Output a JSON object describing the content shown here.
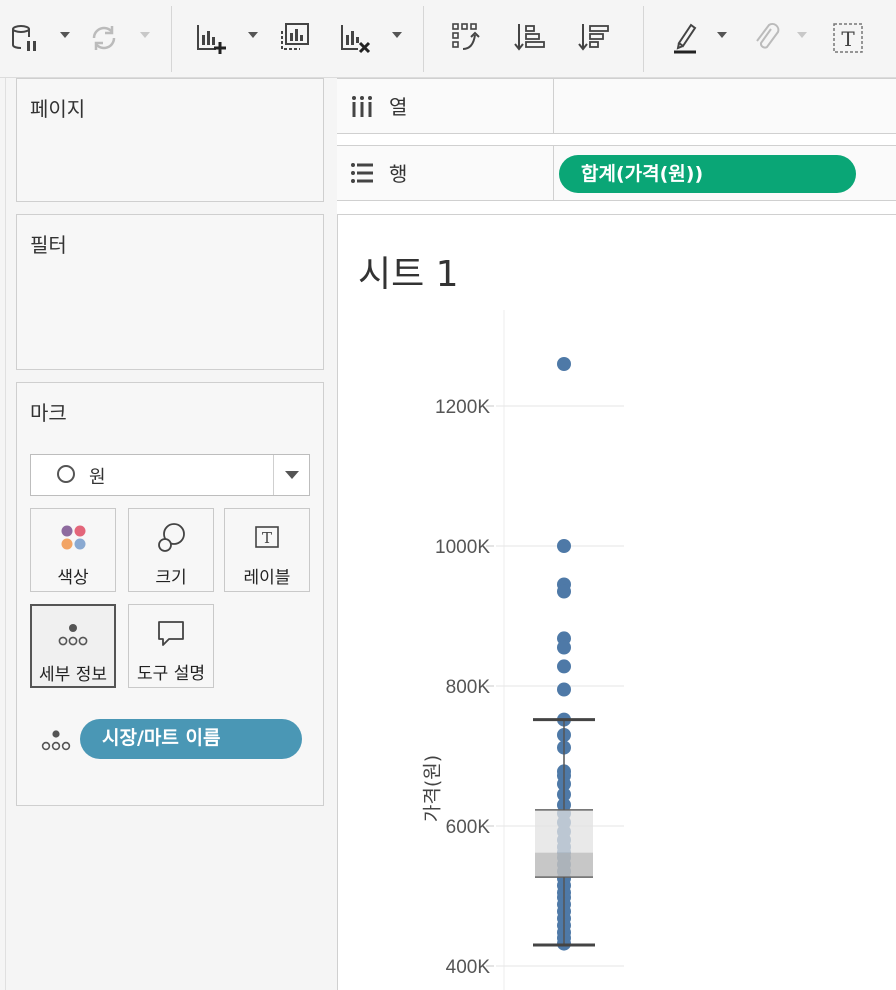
{
  "toolbar": {
    "buttons": [
      {
        "name": "data-source-pause-icon"
      },
      {
        "name": "refresh-icon"
      },
      {
        "name": "new-worksheet-icon"
      },
      {
        "name": "duplicate-sheet-icon"
      },
      {
        "name": "clear-sheet-icon"
      },
      {
        "name": "swap-rows-columns-icon"
      },
      {
        "name": "sort-ascending-icon"
      },
      {
        "name": "sort-descending-icon"
      },
      {
        "name": "highlight-icon"
      },
      {
        "name": "group-members-icon"
      },
      {
        "name": "show-mark-labels-icon"
      }
    ]
  },
  "sidebar": {
    "pages_title": "페이지",
    "filters_title": "필터",
    "marks_title": "마크",
    "mark_type": "원",
    "mark_buttons": {
      "color": "색상",
      "size": "크기",
      "label": "레이블",
      "detail": "세부 정보",
      "tooltip": "도구 설명"
    },
    "detail_pill": "시장/마트 이름"
  },
  "shelves": {
    "columns_label": "열",
    "rows_label": "행",
    "rows_pill": "합계(가격(원))"
  },
  "colors": {
    "rows_pill": "#0aa676",
    "detail_pill": "#4a97b5",
    "mark": "#4e79a7"
  },
  "view": {
    "title": "시트 1"
  },
  "chart_data": {
    "type": "scatter",
    "ylabel": "가격(원)",
    "y_ticks": [
      "400K",
      "600K",
      "800K",
      "1000K",
      "1200K"
    ],
    "ylim": [
      400000,
      1300000
    ],
    "grid": true,
    "values": [
      1260000,
      1000000,
      945000,
      935000,
      868000,
      855000,
      828000,
      795000,
      752000,
      730000,
      712000,
      678000,
      672000,
      660000,
      645000,
      630000,
      618000,
      605000,
      592000,
      580000,
      570000,
      562000,
      555000,
      545000,
      535000,
      525000,
      515000,
      505000,
      498000,
      488000,
      478000,
      468000,
      458000,
      448000,
      440000,
      432000
    ],
    "boxplot": {
      "whisker_low": 430000,
      "q1": 527000,
      "median": 562000,
      "q3": 623000,
      "whisker_high": 752000
    }
  }
}
